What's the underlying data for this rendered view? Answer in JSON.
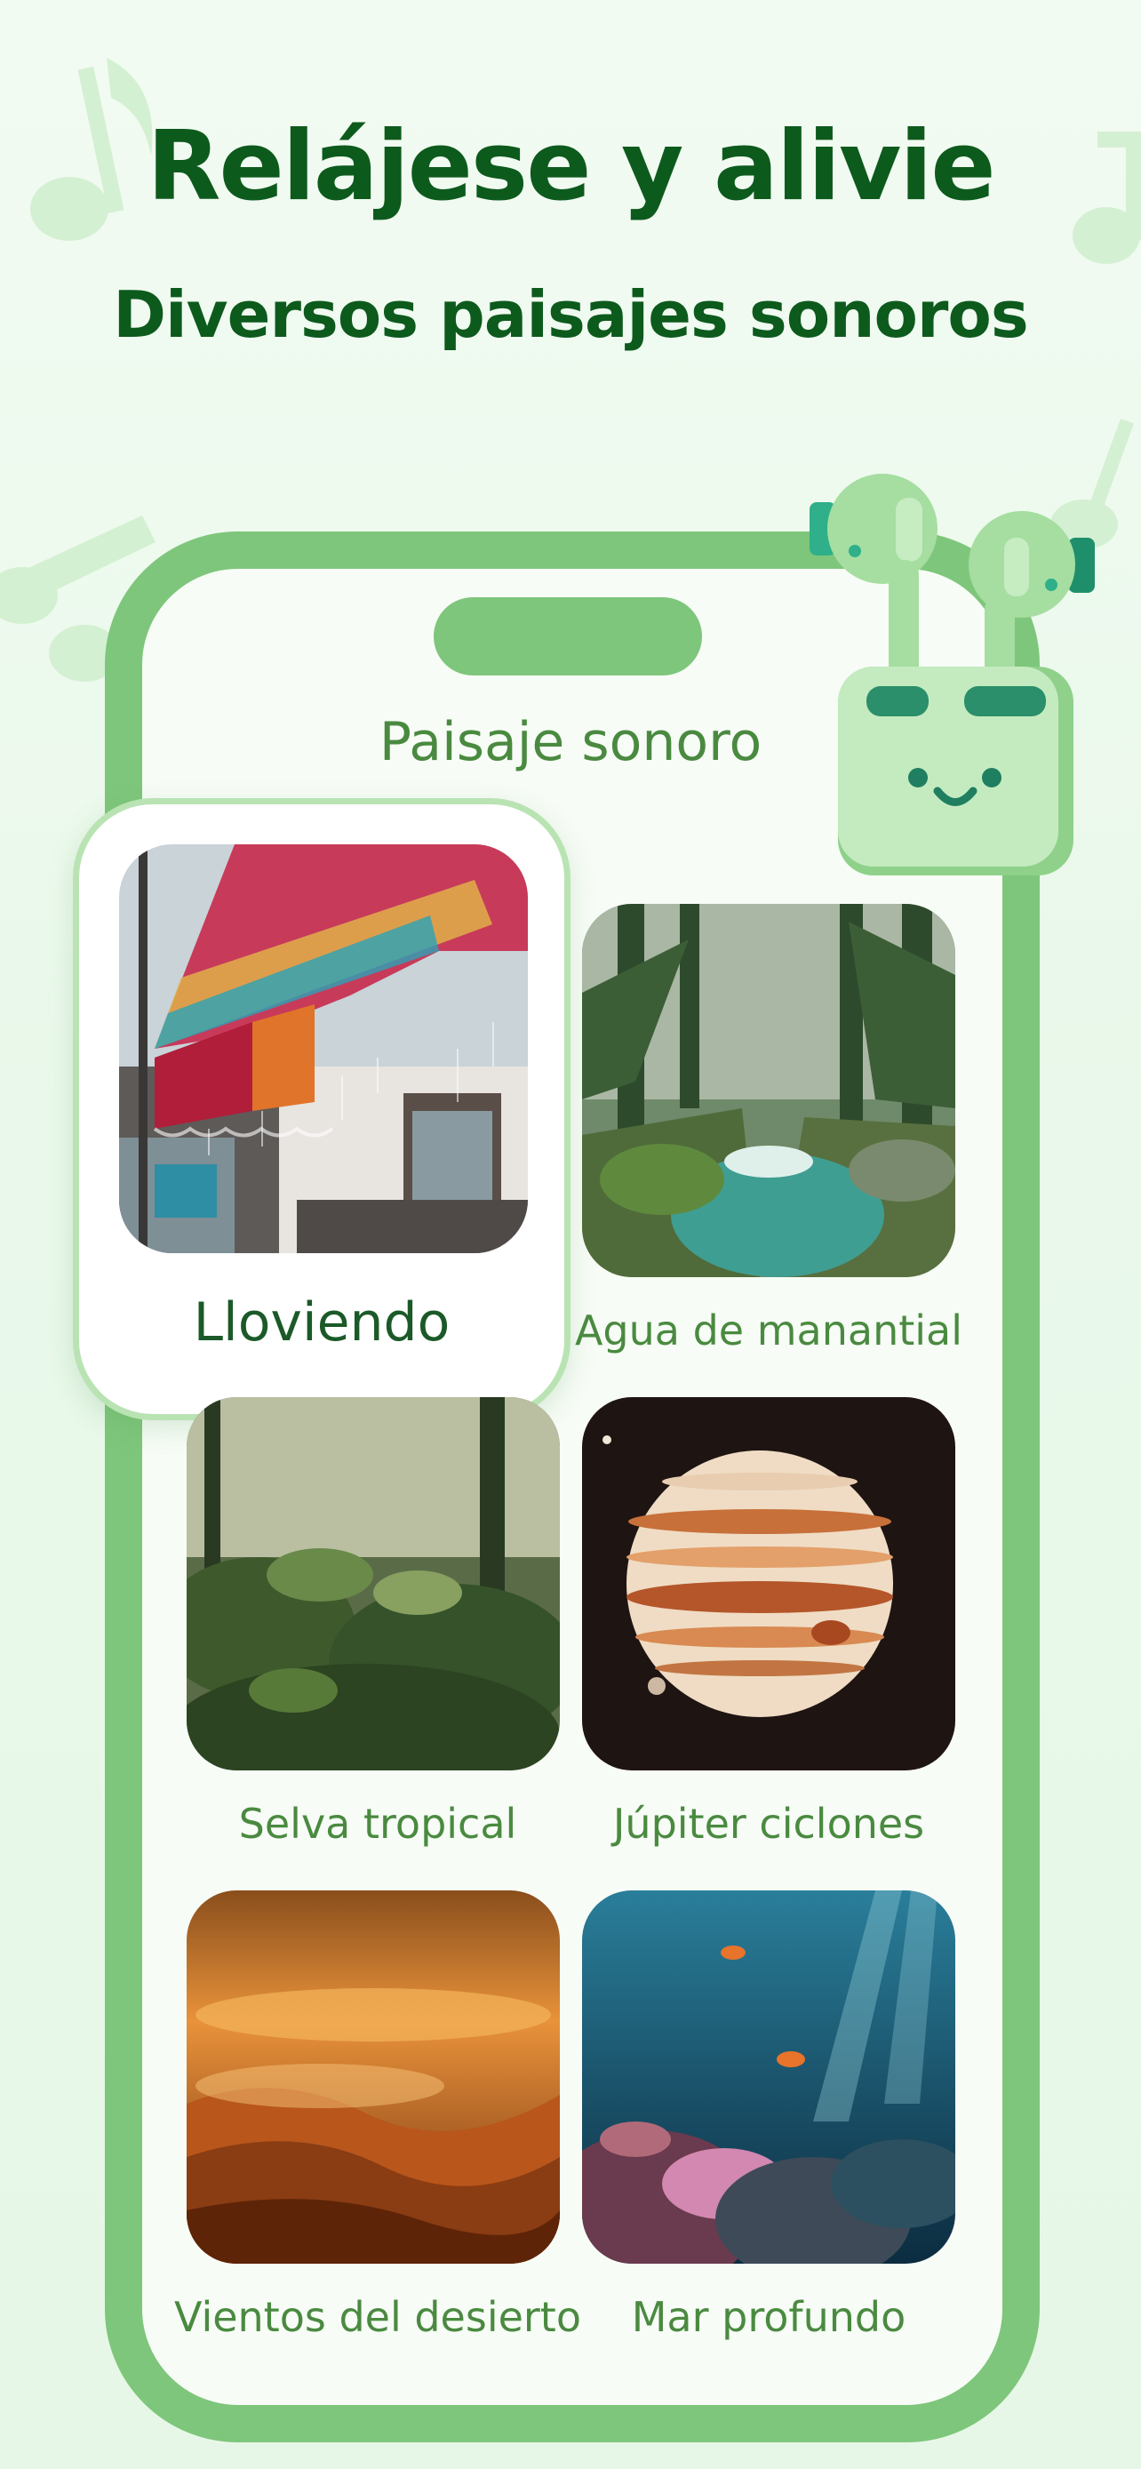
{
  "header": {
    "title": "Relájese y alivie",
    "subtitle": "Diversos paisajes sonoros"
  },
  "screen": {
    "title": "Paisaje sonoro"
  },
  "soundscapes": [
    {
      "label": "Lloviendo",
      "selected": true
    },
    {
      "label": "Agua de manantial",
      "selected": false
    },
    {
      "label": "Selva tropical",
      "selected": false
    },
    {
      "label": "Júpiter ciclones",
      "selected": false
    },
    {
      "label": "Vientos del desierto",
      "selected": false
    },
    {
      "label": "Mar profundo",
      "selected": false
    }
  ],
  "colors": {
    "brand_dark": "#0d5a1d",
    "phone_frame": "#7ec67b",
    "label_green": "#4a8a40"
  },
  "icons": [
    "music-note-icon",
    "earbuds-case-icon"
  ]
}
